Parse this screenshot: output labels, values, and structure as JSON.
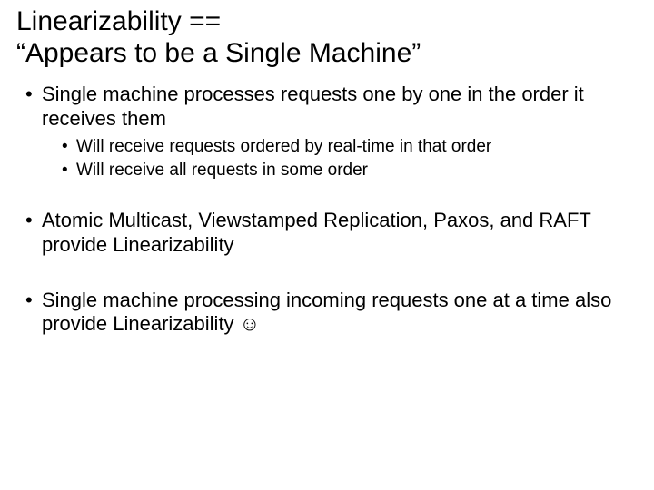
{
  "title_line1": "Linearizability ==",
  "title_line2": "“Appears to be a Single Machine”",
  "bullets": [
    {
      "text": "Single machine processes requests one by one in the order it receives them",
      "sub": [
        "Will receive requests ordered by real-time in that order",
        "Will receive all requests in some order"
      ]
    },
    {
      "text": "Atomic Multicast, Viewstamped Replication, Paxos, and RAFT provide Linearizability"
    },
    {
      "text": "Single machine processing incoming requests one at a time also provide Linearizability ☺"
    }
  ]
}
